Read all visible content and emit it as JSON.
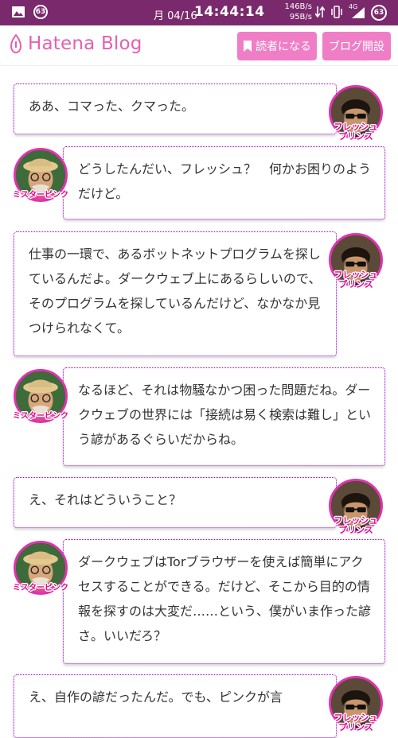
{
  "status_bar": {
    "notification_count": "63",
    "date": "月 04/16",
    "time": "14:44:14",
    "speed_up": "146B/s",
    "speed_down": "95B/s",
    "network": "4G",
    "battery_level": "63"
  },
  "header": {
    "logo_text": "Hatena Blog",
    "subscribe_label": "読者になる",
    "start_blog_label": "ブログ開設"
  },
  "characters": {
    "fresh": "フレッシュ\nプリンス",
    "pink": "ミスターピンク"
  },
  "messages": [
    {
      "speaker": "fresh",
      "text": "ああ、コマった、クマった。"
    },
    {
      "speaker": "pink",
      "text": "どうしたんだい、フレッシュ？　何かお困りのようだけど。"
    },
    {
      "speaker": "fresh",
      "text": "仕事の一環で、あるボットネットプログラムを探しているんだよ。ダークウェブ上にあるらしいので、そのプログラムを探しているんだけど、なかなか見つけられなくて。"
    },
    {
      "speaker": "pink",
      "text": "なるほど、それは物騒なかつ困った問題だね。ダークウェブの世界には「接続は易く検索は難し」という諺があるぐらいだからね。"
    },
    {
      "speaker": "fresh",
      "text": "え、それはどういうこと？"
    },
    {
      "speaker": "pink",
      "text": "ダークウェブはTorブラウザーを使えば簡単にアクセスすることができる。だけど、そこから目的の情報を探すのは大変だ……という、僕がいま作った諺さ。いいだろ？"
    },
    {
      "speaker": "fresh",
      "text": "え、自作の諺だったんだ。でも、ピンクが言"
    }
  ],
  "colors": {
    "status_bar": "#7a2a6c",
    "brand_pink": "#e75fb0",
    "button_pink": "#f07ec6",
    "bubble_border": "#a400c8",
    "avatar_ring": "#e033b0"
  }
}
